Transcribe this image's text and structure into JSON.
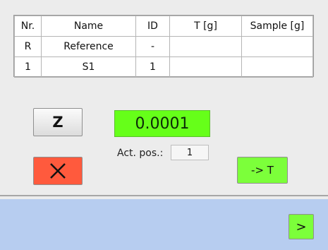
{
  "table": {
    "headers": [
      "Nr.",
      "Name",
      "ID",
      "T [g]",
      "Sample [g]"
    ],
    "rows": [
      [
        "R",
        "Reference",
        "-",
        "",
        ""
      ],
      [
        "1",
        "S1",
        "1",
        "",
        ""
      ]
    ]
  },
  "controls": {
    "z_label": "Z",
    "clear_icon": "x-icon",
    "tare_label": "-> T",
    "next_label": ">"
  },
  "display": {
    "value": "0.0001",
    "act_pos_label": "Act. pos.:",
    "act_pos_value": "1"
  },
  "colors": {
    "display_bg": "#66ff19",
    "clear_bg": "#ff5a3d",
    "action_bg": "#7cff3a",
    "footer_bg": "#b7cdf0"
  }
}
